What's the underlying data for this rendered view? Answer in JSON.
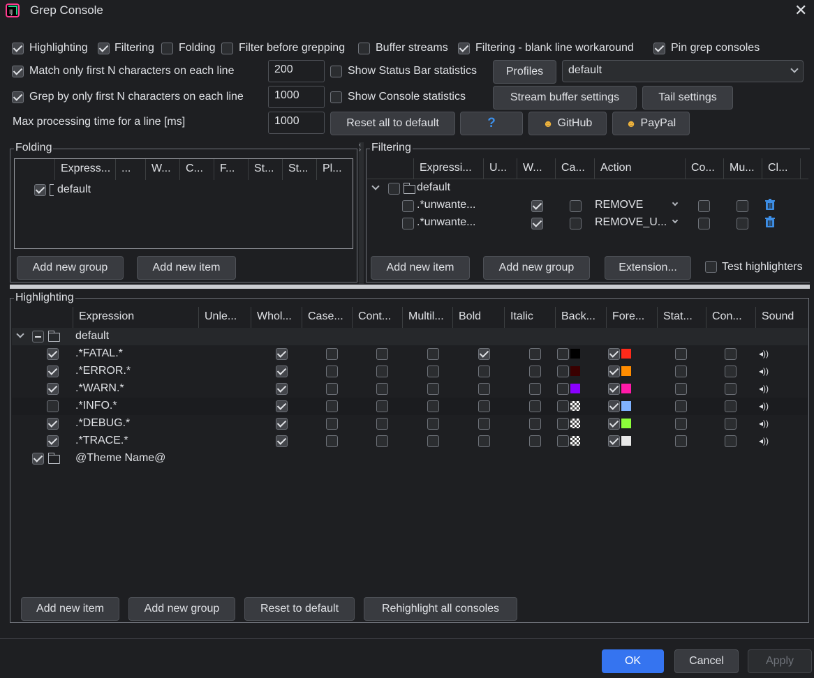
{
  "window": {
    "title": "Grep Console",
    "close": "✕"
  },
  "options": {
    "highlighting": "Highlighting",
    "filtering": "Filtering",
    "folding": "Folding",
    "filter_before": "Filter before grepping",
    "buffer_streams": "Buffer streams",
    "blank_line": "Filtering - blank line workaround",
    "pin": "Pin grep consoles",
    "match_first_n": "Match only first N characters on each line",
    "match_first_n_value": "200",
    "show_status_bar": "Show Status Bar statistics",
    "grep_first_n": "Grep by only first N characters on each line",
    "grep_first_n_value": "1000",
    "show_console": "Show Console statistics",
    "max_processing": "Max processing time for a line [ms]",
    "max_processing_value": "1000"
  },
  "buttons": {
    "profiles": "Profiles",
    "profile_value": "default",
    "stream_buffer": "Stream buffer settings",
    "tail": "Tail settings",
    "reset_all": "Reset all to default",
    "help": "?",
    "github": "GitHub",
    "paypal": "PayPal"
  },
  "folding": {
    "legend": "Folding",
    "headers": [
      "Express...",
      "...",
      "W...",
      "C...",
      "F...",
      "St...",
      "St...",
      "Pl..."
    ],
    "group": "default",
    "add_group": "Add new group",
    "add_item": "Add new item"
  },
  "filtering": {
    "legend": "Filtering",
    "headers": [
      "Expressi...",
      "U...",
      "W...",
      "Ca...",
      "Action",
      "Co...",
      "Mu...",
      "Cl..."
    ],
    "group": "default",
    "rows": [
      {
        "expr": ".*unwante...",
        "action": "REMOVE"
      },
      {
        "expr": ".*unwante...",
        "action": "REMOVE_U..."
      }
    ],
    "add_item": "Add new item",
    "add_group": "Add new group",
    "extension": "Extension...",
    "test": "Test highlighters"
  },
  "highlighting": {
    "legend": "Highlighting",
    "headers": [
      "Expression",
      "Unle...",
      "Whol...",
      "Case...",
      "Cont...",
      "Multil...",
      "Bold",
      "Italic",
      "Back...",
      "Fore...",
      "Stat...",
      "Con...",
      "Sound"
    ],
    "group": "default",
    "rows": [
      {
        "enabled": true,
        "expr": ".*FATAL.*",
        "bold": true,
        "back": "#000000",
        "fore": "#ff2a1a"
      },
      {
        "enabled": true,
        "expr": ".*ERROR.*",
        "bold": false,
        "back": "#3a0000",
        "fore": "#ff8c00"
      },
      {
        "enabled": true,
        "expr": ".*WARN.*",
        "bold": false,
        "back": "#8a00ff",
        "fore": "#ff1aa8"
      },
      {
        "enabled": false,
        "expr": ".*INFO.*",
        "bold": false,
        "back": "checker",
        "fore": "#7fb2ff"
      },
      {
        "enabled": true,
        "expr": ".*DEBUG.*",
        "bold": false,
        "back": "checker",
        "fore": "#8cff3a"
      },
      {
        "enabled": true,
        "expr": ".*TRACE.*",
        "bold": false,
        "back": "checker",
        "fore": "#e8e8e8"
      }
    ],
    "theme_group": "@Theme Name@",
    "add_item": "Add new item",
    "add_group": "Add new group",
    "reset": "Reset to default",
    "rehighlight": "Rehighlight all consoles"
  },
  "footer": {
    "ok": "OK",
    "cancel": "Cancel",
    "apply": "Apply"
  }
}
